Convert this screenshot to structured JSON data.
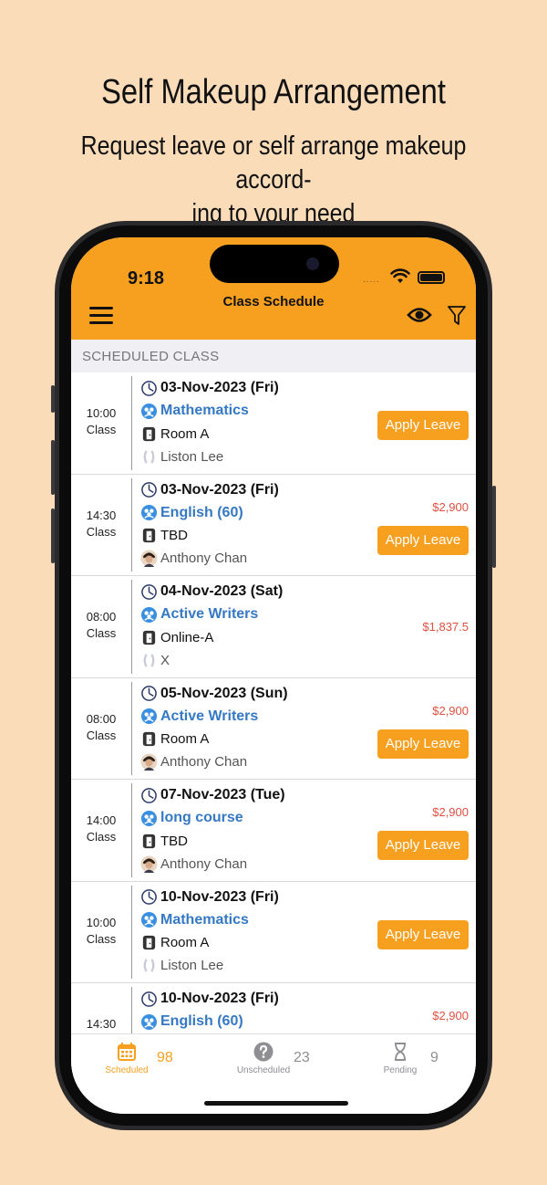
{
  "promo": {
    "title": "Self Makeup Arrangement",
    "subtitle_line1": "Request leave or self arrange makeup accord-",
    "subtitle_line2": "ing to your need"
  },
  "status_bar": {
    "time": "9:18",
    "dots": "....."
  },
  "header": {
    "title": "Class Schedule",
    "icons": [
      "menu-icon",
      "eye-icon",
      "filter-icon"
    ]
  },
  "section_title": "SCHEDULED CLASS",
  "apply_label": "Apply Leave",
  "classes": [
    {
      "time": "10:00",
      "type": "Class",
      "date": "03-Nov-2023 (Fri)",
      "subject": "Mathematics",
      "room": "Room A",
      "teacher": "Liston Lee",
      "teacher_avatar": "placeholder-avatar",
      "price": "",
      "apply": true
    },
    {
      "time": "14:30",
      "type": "Class",
      "date": "03-Nov-2023 (Fri)",
      "subject": "English (60)",
      "room": "TBD",
      "teacher": "Anthony Chan",
      "teacher_avatar": "photo-avatar",
      "price": "$2,900",
      "apply": true
    },
    {
      "time": "08:00",
      "type": "Class",
      "date": "04-Nov-2023 (Sat)",
      "subject": "Active Writers",
      "room": "Online-A",
      "teacher": "X",
      "teacher_avatar": "placeholder-avatar",
      "price": "$1,837.5",
      "apply": false
    },
    {
      "time": "08:00",
      "type": "Class",
      "date": "05-Nov-2023 (Sun)",
      "subject": "Active Writers",
      "room": "Room A",
      "teacher": "Anthony Chan",
      "teacher_avatar": "photo-avatar",
      "price": "$2,900",
      "apply": true
    },
    {
      "time": "14:00",
      "type": "Class",
      "date": "07-Nov-2023 (Tue)",
      "subject": "long course",
      "room": "TBD",
      "teacher": "Anthony Chan",
      "teacher_avatar": "photo-avatar",
      "price": "$2,900",
      "apply": true
    },
    {
      "time": "10:00",
      "type": "Class",
      "date": "10-Nov-2023 (Fri)",
      "subject": "Mathematics",
      "room": "Room A",
      "teacher": "Liston Lee",
      "teacher_avatar": "placeholder-avatar",
      "price": "",
      "apply": true
    },
    {
      "time": "14:30",
      "type": "",
      "date": "10-Nov-2023 (Fri)",
      "subject": "English (60)",
      "room": "",
      "teacher": "",
      "teacher_avatar": "",
      "price": "$2,900",
      "apply": true
    }
  ],
  "tabs": [
    {
      "label": "Scheduled",
      "count": "98",
      "icon": "calendar-icon",
      "active": true
    },
    {
      "label": "Unscheduled",
      "count": "23",
      "icon": "question-icon",
      "active": false
    },
    {
      "label": "Pending",
      "count": "9",
      "icon": "hourglass-icon",
      "active": false
    }
  ],
  "colors": {
    "accent": "#f7a020",
    "subject": "#3578c4",
    "price": "#e05040",
    "background": "#fadcb9"
  }
}
